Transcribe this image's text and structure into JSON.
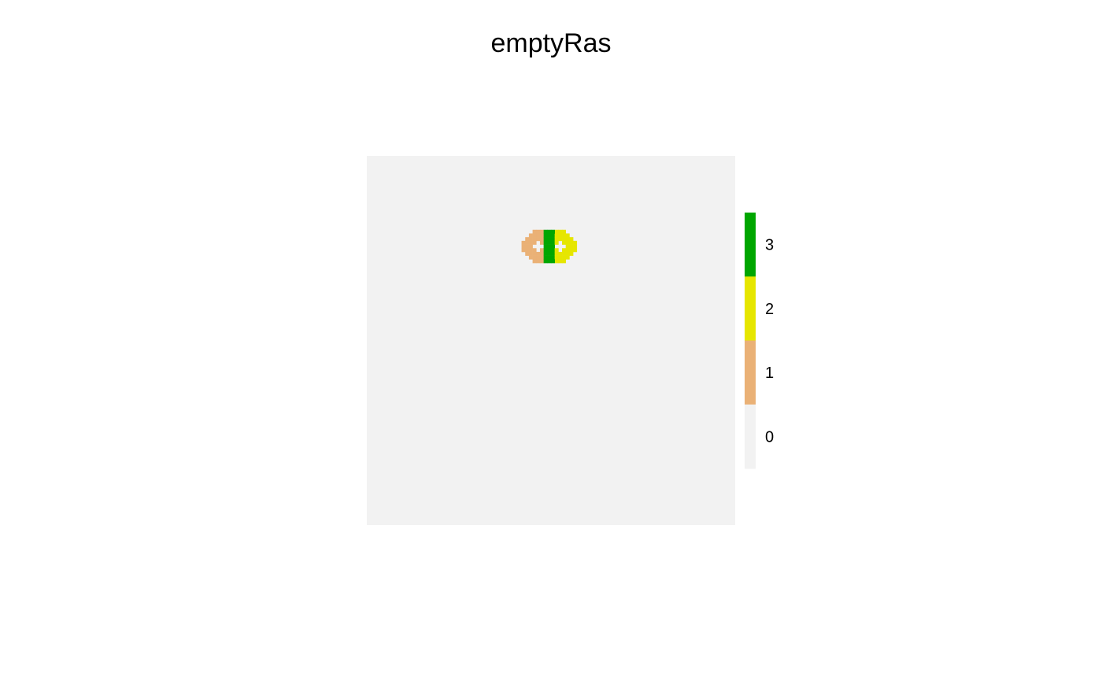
{
  "chart_data": {
    "type": "heatmap",
    "title": "emptyRas",
    "xlabel": "",
    "ylabel": "",
    "grid": false,
    "axes_visible": false,
    "legend_placement": "right",
    "background_value": 0,
    "legend": [
      {
        "value": 3,
        "label": "3",
        "color": "#00a600"
      },
      {
        "value": 2,
        "label": "2",
        "color": "#e6e600"
      },
      {
        "value": 1,
        "label": "1",
        "color": "#eab176"
      },
      {
        "value": 0,
        "label": "0",
        "color": "#f2f2f2"
      }
    ],
    "grid_size": [
      100,
      100
    ],
    "features": [
      {
        "value": 1,
        "shape": "ring",
        "center_cell": [
          46,
          24
        ],
        "inner_radius_cells": 1.4,
        "outer_radius_cells": 4.2
      },
      {
        "value": 2,
        "shape": "ring",
        "center_cell": [
          52,
          24
        ],
        "inner_radius_cells": 1.4,
        "outer_radius_cells": 4.2
      },
      {
        "value": 3,
        "shape": "overlap",
        "cells_x": [
          48,
          50
        ],
        "cells_y": [
          20,
          28
        ]
      }
    ]
  }
}
